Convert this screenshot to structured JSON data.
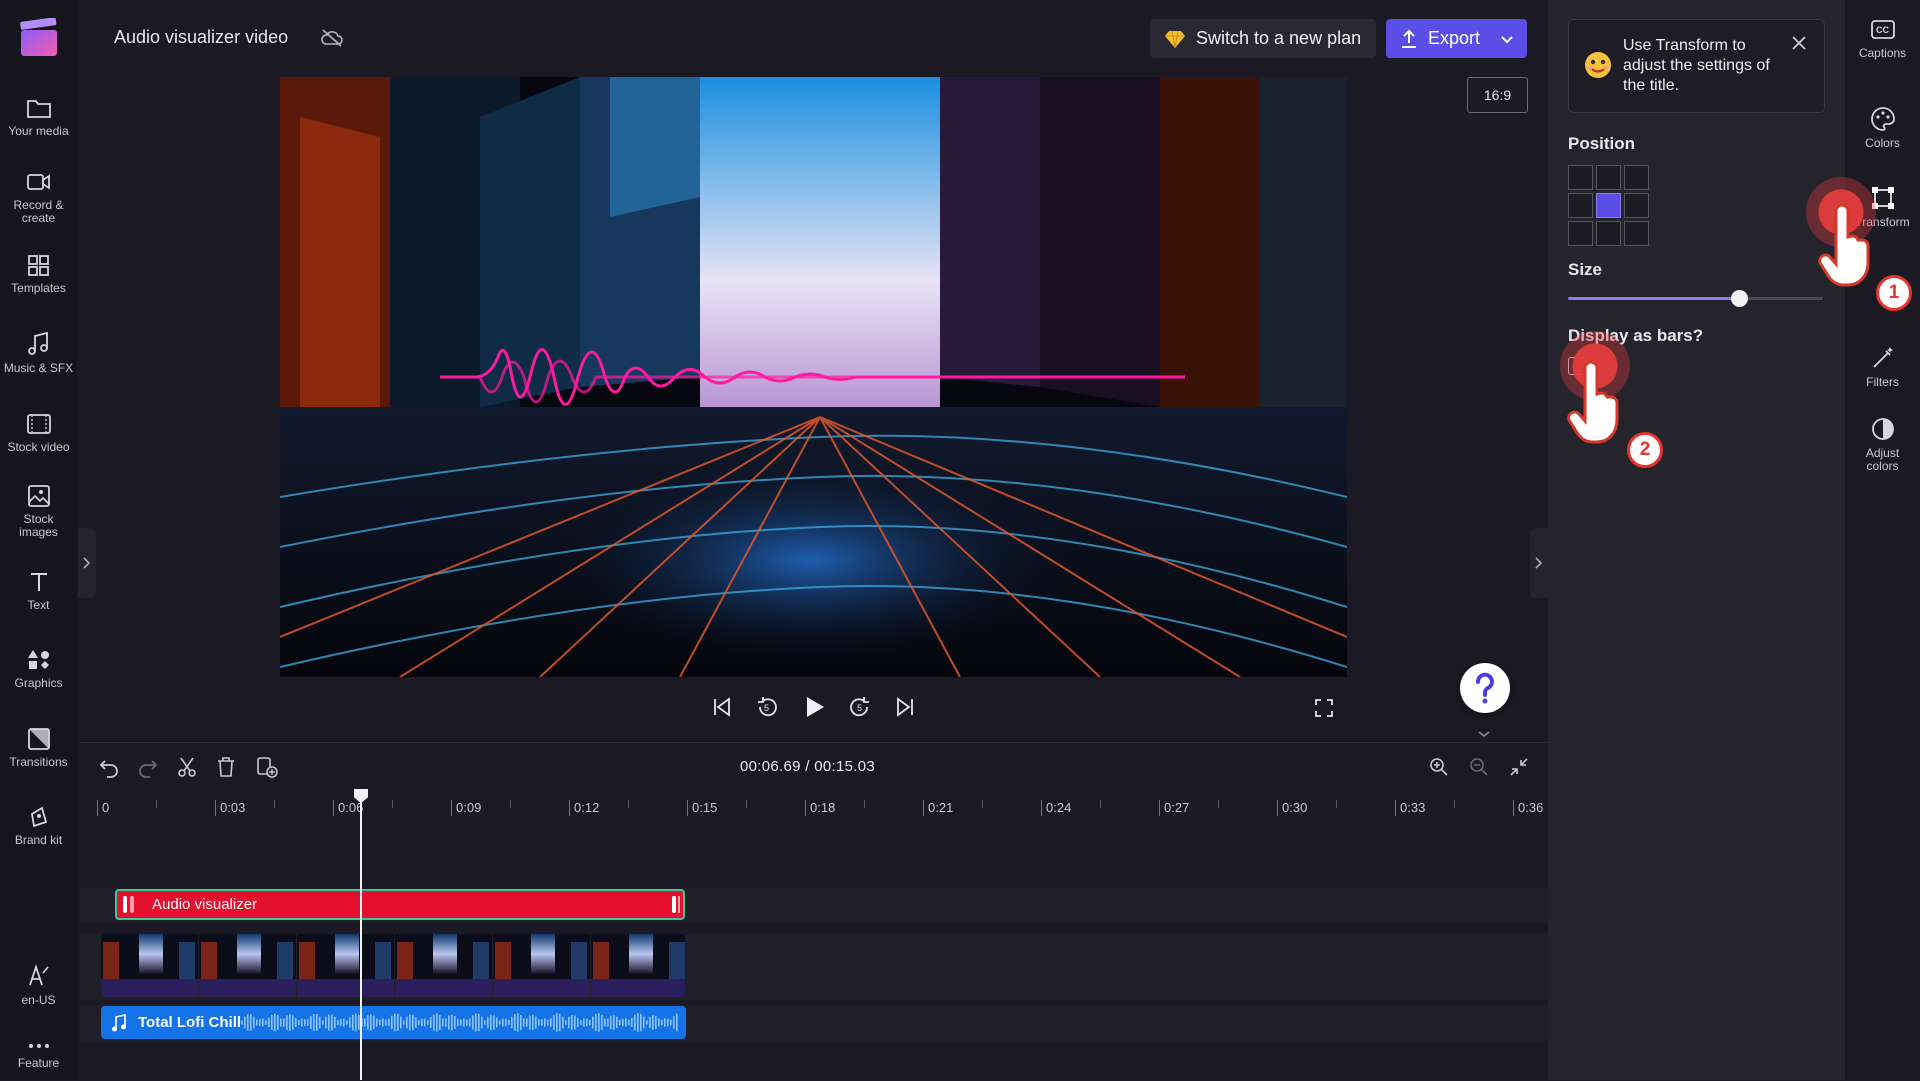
{
  "project": {
    "title": "Audio visualizer video"
  },
  "header": {
    "plan_label": "Switch to a new plan",
    "export_label": "Export"
  },
  "preview": {
    "aspect_ratio": "16:9"
  },
  "left_rail": {
    "items": [
      {
        "label": "Your media",
        "icon": "folder-icon"
      },
      {
        "label": "Record &\ncreate",
        "icon": "camera-icon"
      },
      {
        "label": "Templates",
        "icon": "templates-icon"
      },
      {
        "label": "Music & SFX",
        "icon": "music-icon"
      },
      {
        "label": "Stock video",
        "icon": "film-icon"
      },
      {
        "label": "Stock\nimages",
        "icon": "image-icon"
      },
      {
        "label": "Text",
        "icon": "text-icon"
      },
      {
        "label": "Graphics",
        "icon": "shapes-icon"
      },
      {
        "label": "Transitions",
        "icon": "transition-icon"
      },
      {
        "label": "Brand kit",
        "icon": "brand-icon"
      },
      {
        "label": "en-US",
        "icon": "language-icon"
      },
      {
        "label": "Feature",
        "icon": "more-icon"
      }
    ]
  },
  "timeline": {
    "current_time": "00:06.69",
    "separator": "/",
    "total_time": "00:15.03",
    "ticks": [
      "0",
      "0:03",
      "0:06",
      "0:09",
      "0:12",
      "0:15",
      "0:18",
      "0:21",
      "0:24",
      "0:27",
      "0:30",
      "0:33",
      "0:36"
    ],
    "clips": {
      "visualizer": "Audio visualizer",
      "audio": "Total Lofi Chill"
    }
  },
  "panel": {
    "tooltip": "Use Transform to adjust the settings of the title.",
    "position_label": "Position",
    "position_selected": "center",
    "size_label": "Size",
    "size_value": 0.67,
    "bars_label": "Display as bars?",
    "bars_checked": false
  },
  "far_rail": {
    "items": [
      {
        "label": "Captions",
        "icon": "captions-icon"
      },
      {
        "label": "Colors",
        "icon": "palette-icon"
      },
      {
        "label": "Transform",
        "icon": "transform-icon"
      },
      {
        "label": "Filters",
        "icon": "filters-icon"
      },
      {
        "label": "Adjust\ncolors",
        "icon": "adjust-icon"
      }
    ]
  },
  "annotations": {
    "step1": "1",
    "step2": "2"
  },
  "colors": {
    "accent": "#5b4ee6",
    "visualizer_clip": "#e5102e",
    "audio_clip": "#1473e6",
    "annotation": "#e8342c"
  }
}
